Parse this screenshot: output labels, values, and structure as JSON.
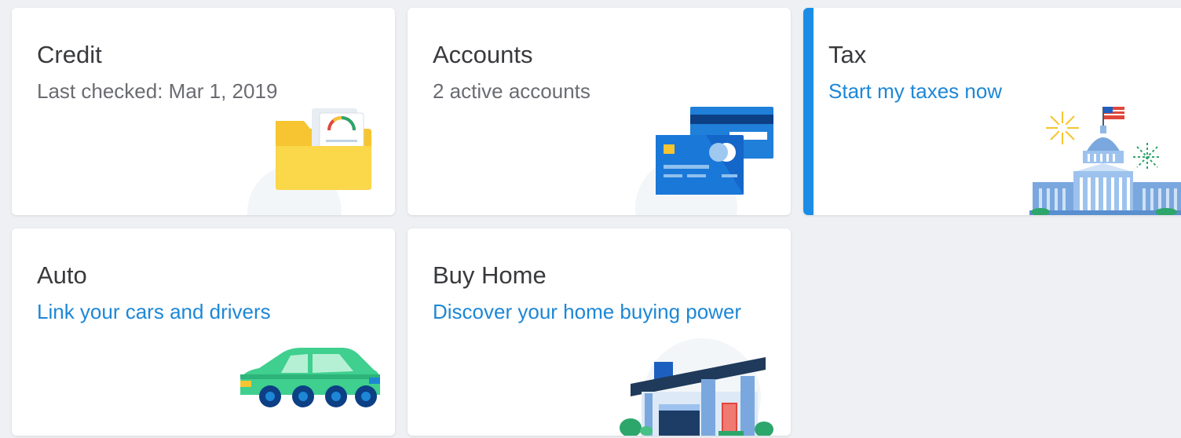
{
  "cards": [
    {
      "key": "credit",
      "title": "Credit",
      "subtitle": "Last checked: Mar 1, 2019",
      "subtitle_is_link": false,
      "icon": "credit-report-folder-icon"
    },
    {
      "key": "accounts",
      "title": "Accounts",
      "subtitle": "2 active accounts",
      "subtitle_is_link": false,
      "icon": "credit-cards-icon"
    },
    {
      "key": "tax",
      "title": "Tax",
      "subtitle": "Start my taxes now",
      "subtitle_is_link": true,
      "icon": "capitol-building-icon",
      "highlighted": true
    },
    {
      "key": "auto",
      "title": "Auto",
      "subtitle": "Link your cars and drivers",
      "subtitle_is_link": true,
      "icon": "car-icon"
    },
    {
      "key": "buy_home",
      "title": "Buy Home",
      "subtitle": "Discover your home buying power",
      "subtitle_is_link": true,
      "icon": "house-icon"
    }
  ],
  "colors": {
    "background": "#eef0f3",
    "card": "#ffffff",
    "title_text": "#393a3d",
    "muted_text": "#6b6c72",
    "link_text": "#1d87d6",
    "accent": "#1c8de6"
  }
}
